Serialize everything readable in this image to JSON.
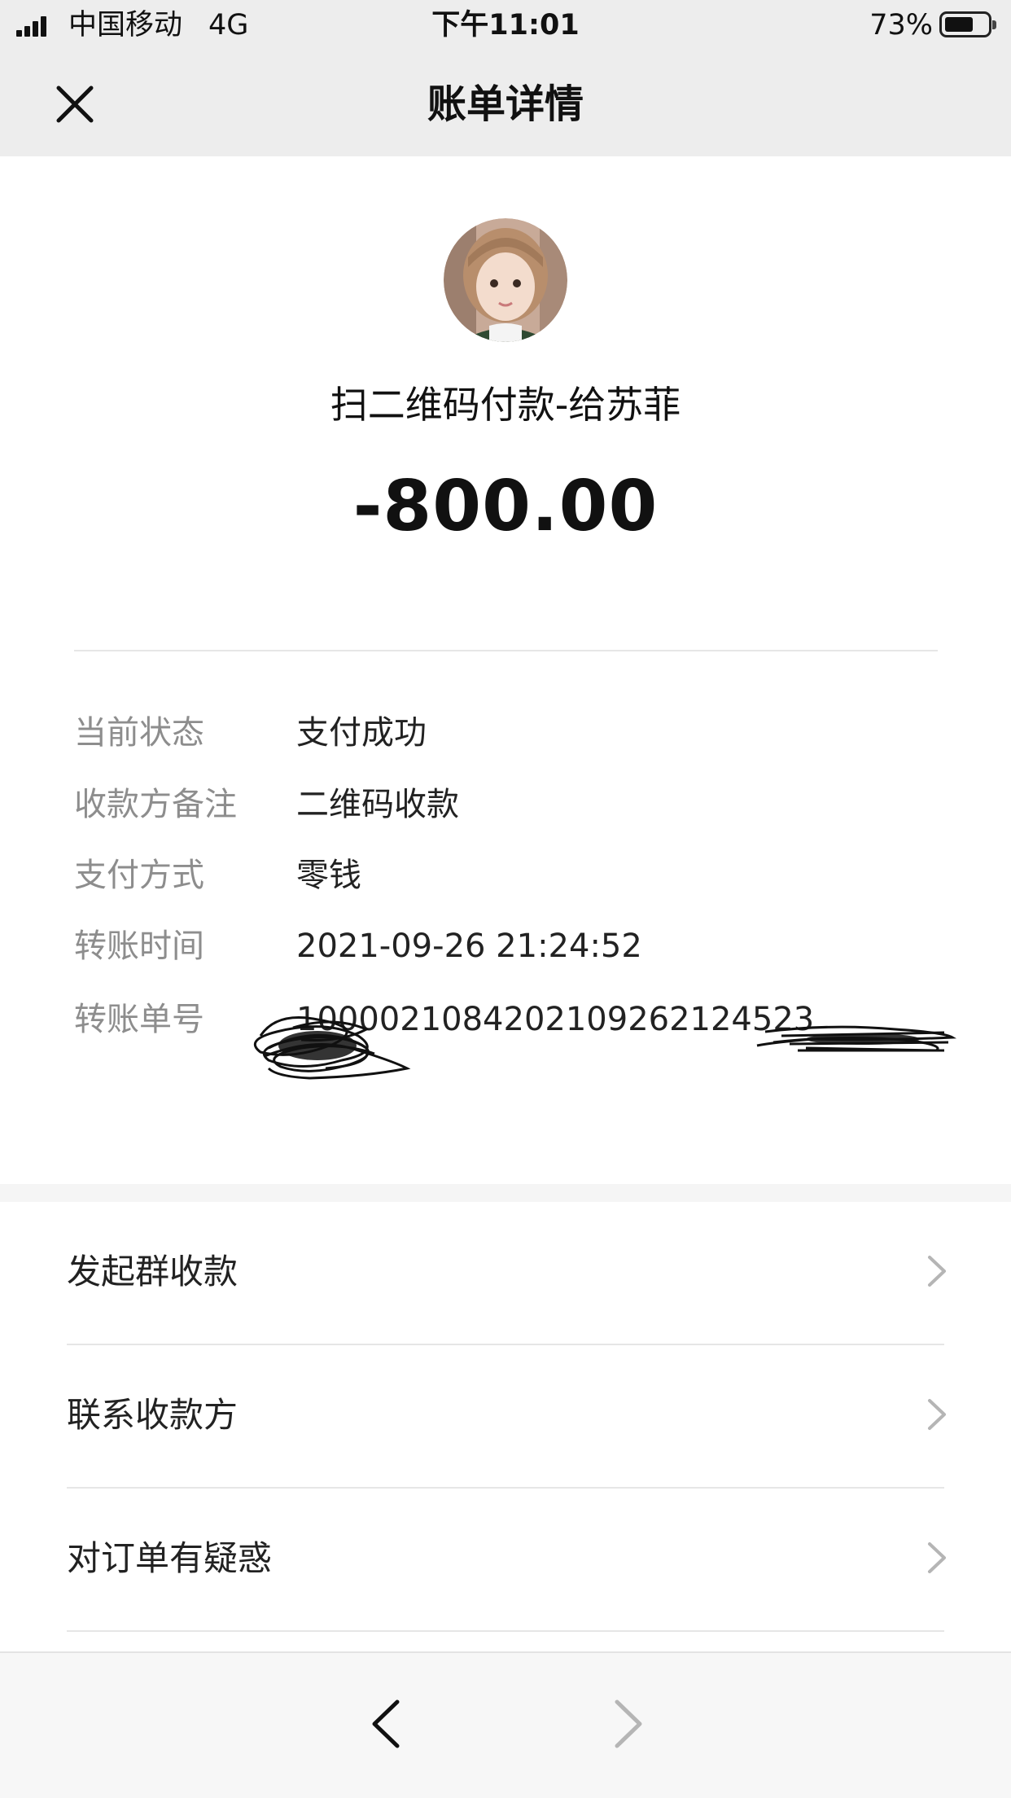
{
  "status_bar": {
    "carrier": "中国移动",
    "network": "4G",
    "time": "下午11:01",
    "battery_percent": "73%",
    "battery_level": 0.73,
    "icons": [
      "signal-icon",
      "battery-icon"
    ]
  },
  "nav": {
    "title": "账单详情",
    "close_icon": "close-icon"
  },
  "payment": {
    "merchant": "扫二维码付款-给苏菲",
    "amount": "-800.00"
  },
  "details": [
    {
      "label": "当前状态",
      "value": "支付成功"
    },
    {
      "label": "收款方备注",
      "value": "二维码收款"
    },
    {
      "label": "支付方式",
      "value": "零钱"
    },
    {
      "label": "转账时间",
      "value": "2021-09-26 21:24:52"
    },
    {
      "label": "转账单号",
      "value": "1000021084202109262124523"
    }
  ],
  "actions": [
    {
      "label": "发起群收款"
    },
    {
      "label": "联系收款方"
    },
    {
      "label": "对订单有疑惑"
    }
  ],
  "toolbar": {
    "back_icon": "chevron-left-icon",
    "forward_icon": "chevron-right-icon"
  },
  "colors": {
    "header_bg": "#ededed",
    "label_gray": "#8d8d8d",
    "text": "#111111"
  }
}
